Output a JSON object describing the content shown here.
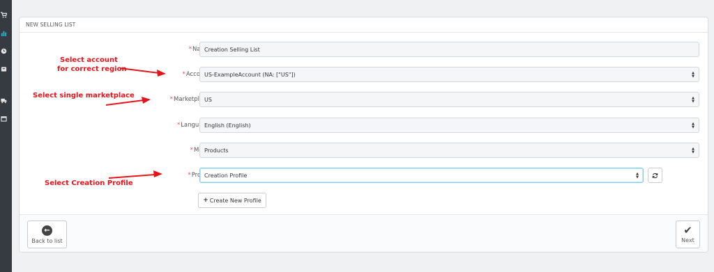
{
  "panel": {
    "heading": "NEW SELLING LIST"
  },
  "form": {
    "required_mark": "*",
    "name": {
      "label": "Name:",
      "value": "Creation Selling List"
    },
    "account": {
      "label": "Account:",
      "value": "US-ExampleAccount (NA: [\"US\"])"
    },
    "marketplace": {
      "label": "Marketplace:",
      "value": "US"
    },
    "language": {
      "label": "Language:",
      "value": "English (English)"
    },
    "mode": {
      "label": "Mode:",
      "value": "Products"
    },
    "profile": {
      "label": "Profile:",
      "value": "Creation Profile"
    },
    "create_profile_label": "Create New Profile"
  },
  "footer": {
    "back_label": "Back to list",
    "next_label": "Next"
  },
  "annotations": {
    "account_line1": "Select account",
    "account_line2": "for correct region",
    "marketplace": "Select single marketplace",
    "profile": "Select Creation Profile"
  },
  "colors": {
    "annotation": "#e3151b",
    "required": "#e84e4e",
    "sidebar": "#363a41",
    "sidebar_active": "#25b9d7",
    "focus_border": "#7cc9e8"
  },
  "icons": {
    "sidebar": [
      "cart-icon",
      "chart-icon",
      "clock-icon",
      "box-icon",
      "truck-icon",
      "calendar-icon"
    ],
    "refresh": "refresh-icon",
    "plus": "plus-icon",
    "back": "arrow-left-circle-icon",
    "next": "check-icon"
  }
}
